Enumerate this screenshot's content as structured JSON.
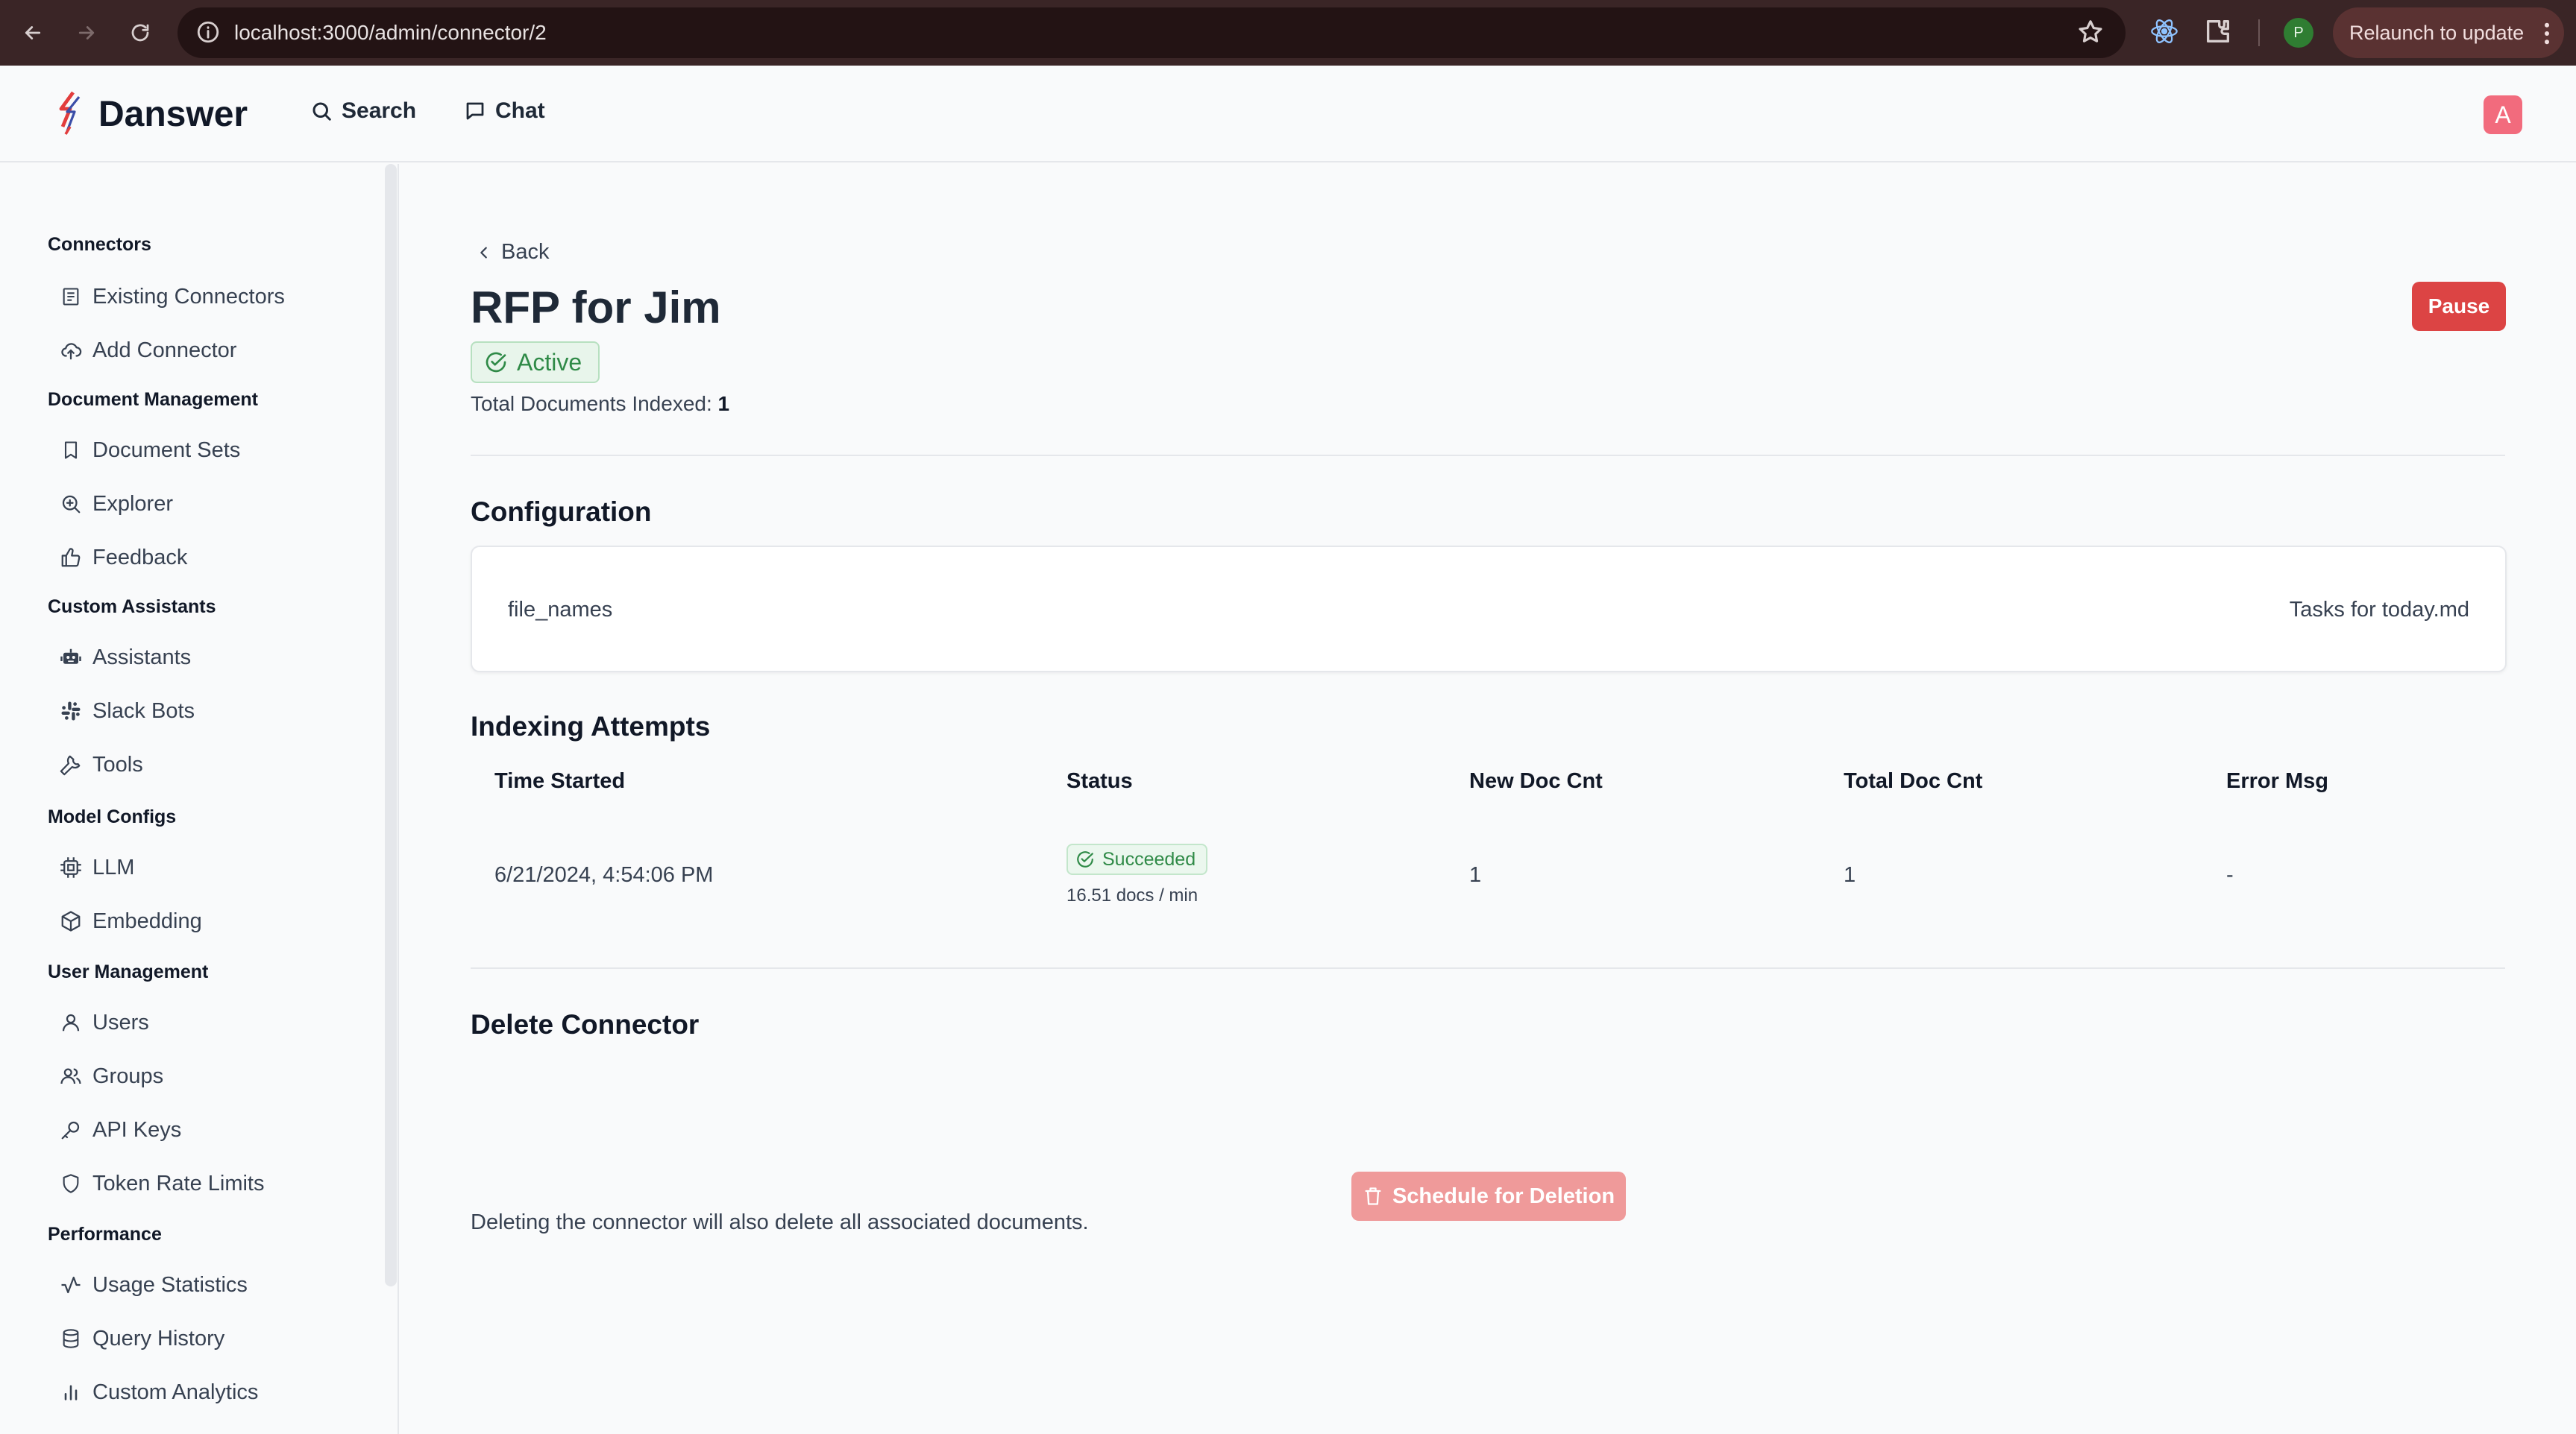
{
  "browser": {
    "url": "localhost:3000/admin/connector/2",
    "profile_initial": "P",
    "relaunch_label": "Relaunch to update"
  },
  "header": {
    "brand": "Danswer",
    "nav": [
      {
        "label": "Search",
        "icon": "search-icon"
      },
      {
        "label": "Chat",
        "icon": "chat-bubble-icon"
      }
    ],
    "avatar_initial": "A"
  },
  "sidebar": {
    "sections": [
      {
        "title": "Connectors",
        "items": [
          {
            "label": "Existing Connectors",
            "icon": "list-icon"
          },
          {
            "label": "Add Connector",
            "icon": "cloud-upload-icon"
          }
        ]
      },
      {
        "title": "Document Management",
        "items": [
          {
            "label": "Document Sets",
            "icon": "bookmark-icon"
          },
          {
            "label": "Explorer",
            "icon": "zoom-in-icon"
          },
          {
            "label": "Feedback",
            "icon": "thumbs-up-icon"
          }
        ]
      },
      {
        "title": "Custom Assistants",
        "items": [
          {
            "label": "Assistants",
            "icon": "robot-icon"
          },
          {
            "label": "Slack Bots",
            "icon": "slack-icon"
          },
          {
            "label": "Tools",
            "icon": "wrench-icon"
          }
        ]
      },
      {
        "title": "Model Configs",
        "items": [
          {
            "label": "LLM",
            "icon": "cpu-icon"
          },
          {
            "label": "Embedding",
            "icon": "cube-icon"
          }
        ]
      },
      {
        "title": "User Management",
        "items": [
          {
            "label": "Users",
            "icon": "user-icon"
          },
          {
            "label": "Groups",
            "icon": "users-icon"
          },
          {
            "label": "API Keys",
            "icon": "key-icon"
          },
          {
            "label": "Token Rate Limits",
            "icon": "shield-icon"
          }
        ]
      },
      {
        "title": "Performance",
        "items": [
          {
            "label": "Usage Statistics",
            "icon": "activity-icon"
          },
          {
            "label": "Query History",
            "icon": "database-icon"
          },
          {
            "label": "Custom Analytics",
            "icon": "bar-chart-icon"
          }
        ]
      }
    ]
  },
  "main": {
    "back_label": "Back",
    "title": "RFP for Jim",
    "pause_label": "Pause",
    "status_label": "Active",
    "total_docs_label": "Total Documents Indexed:",
    "total_docs_value": "1",
    "configuration": {
      "title": "Configuration",
      "key": "file_names",
      "value": "Tasks for today.md"
    },
    "indexing": {
      "title": "Indexing Attempts",
      "columns": [
        "Time Started",
        "Status",
        "New Doc Cnt",
        "Total Doc Cnt",
        "Error Msg"
      ],
      "rows": [
        {
          "time_started": "6/21/2024, 4:54:06 PM",
          "status": "Succeeded",
          "rate": "16.51 docs / min",
          "new_doc_cnt": "1",
          "total_doc_cnt": "1",
          "error_msg": "-"
        }
      ]
    },
    "delete": {
      "title": "Delete Connector",
      "description": "Deleting the connector will also delete all associated documents.",
      "button_label": "Schedule for Deletion"
    }
  },
  "colors": {
    "pause": "#dc4444",
    "active_green": "#2f8a47",
    "delete_disabled": "#ef9a9a",
    "avatar": "#f26b7d"
  }
}
